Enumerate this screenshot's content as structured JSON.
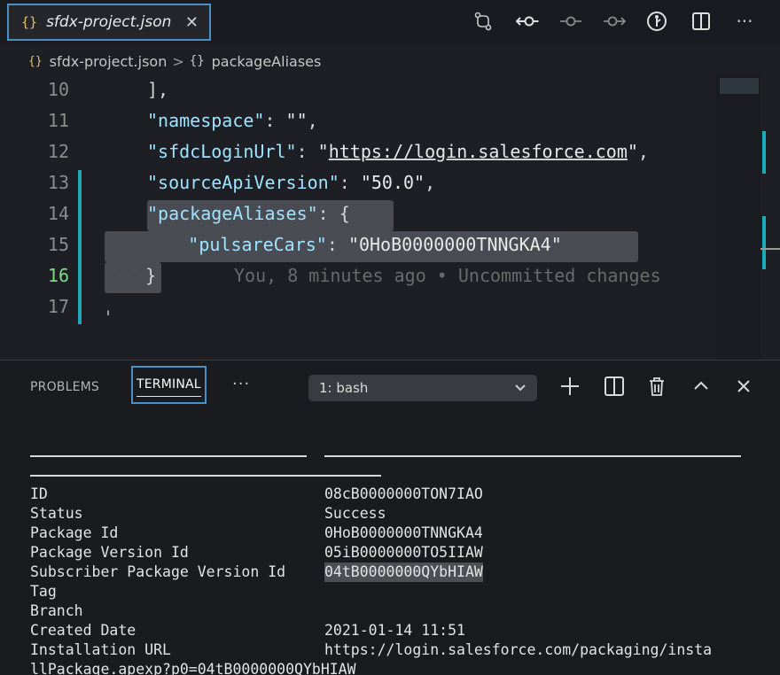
{
  "tab": {
    "icon": "{}",
    "title": "sfdx-project.json",
    "close": "✕"
  },
  "toolbar": {
    "icons": [
      "compare-changes-icon",
      "git-previous-icon",
      "git-commit-icon",
      "git-next-icon",
      "git-lens-icon",
      "split-editor-icon",
      "more-actions-icon"
    ]
  },
  "breadcrumb": {
    "icon": "{}",
    "file": "sfdx-project.json",
    "separator": ">",
    "object_icon": "{}",
    "node": "packageAliases"
  },
  "editor": {
    "lines": [
      {
        "num": "10",
        "code": "],",
        "type": "plain"
      },
      {
        "num": "11",
        "key": "\"namespace\"",
        "colon": ": ",
        "value": "\"\"",
        "tail": ","
      },
      {
        "num": "12",
        "key": "\"sfdcLoginUrl\"",
        "colon": ": ",
        "q1": "\"",
        "url": "https://login.salesforce.com",
        "q2": "\"",
        "tail": ","
      },
      {
        "num": "13",
        "key": "\"sourceApiVersion\"",
        "colon": ": ",
        "value": "\"50.0\"",
        "tail": ","
      },
      {
        "num": "14",
        "key": "\"packageAliases\"",
        "colon": ": ",
        "value": "{",
        "tail": ""
      },
      {
        "num": "15",
        "key": "\"pulsareCars\"",
        "colon": ": ",
        "value": "\"0HoB0000000TNNGKA4\"",
        "tail": ""
      },
      {
        "num": "16",
        "value": "}",
        "blame": "You, 8 minutes ago • Uncommitted changes"
      },
      {
        "num": "17",
        "value": ""
      }
    ],
    "active_line": "16",
    "accent_color": "#1fa9b8"
  },
  "panel": {
    "tabs": {
      "problems": "PROBLEMS",
      "terminal": "TERMINAL",
      "more": "···"
    },
    "shell_select": {
      "value": "1: bash",
      "chevron": "⌄"
    },
    "icons": [
      "new-terminal-icon",
      "split-terminal-icon",
      "kill-terminal-icon",
      "maximize-panel-icon",
      "close-panel-icon"
    ]
  },
  "terminal": {
    "rows": [
      {
        "label": "ID",
        "value": "08cB0000000TON7IAO"
      },
      {
        "label": "Status",
        "value": "Success"
      },
      {
        "label": "Package Id",
        "value": "0HoB0000000TNNGKA4"
      },
      {
        "label": "Package Version Id",
        "value": "05iB0000000TO5IIAW"
      },
      {
        "label": "Subscriber Package Version Id",
        "value": "04tB0000000QYbHIAW",
        "highlight": true
      },
      {
        "label": "Tag",
        "value": ""
      },
      {
        "label": "Branch",
        "value": ""
      },
      {
        "label": "Created Date",
        "value": "2021-01-14 11:51"
      },
      {
        "label": "Installation URL",
        "value": "https://login.salesforce.com/packaging/insta"
      }
    ],
    "wrap_line": "llPackage.apexp?p0=04tB0000000QYbHIAW"
  }
}
